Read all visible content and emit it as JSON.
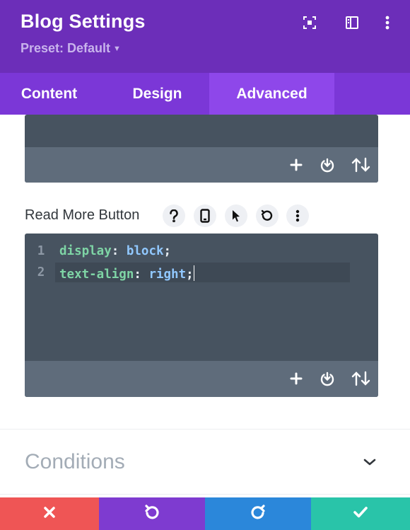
{
  "header": {
    "title": "Blog Settings",
    "preset": "Preset: Default",
    "icons": [
      "focus-icon",
      "sidebar-layout-icon",
      "more-vertical-icon"
    ]
  },
  "tabs": [
    {
      "label": "Content",
      "active": false
    },
    {
      "label": "Design",
      "active": false
    },
    {
      "label": "Advanced",
      "active": true
    }
  ],
  "editor_prev": {
    "actions": [
      "add-icon",
      "download-icon",
      "sort-icon"
    ]
  },
  "read_more": {
    "label": "Read More Button",
    "options": [
      "help-icon",
      "mobile-icon",
      "cursor-icon",
      "reset-icon",
      "more-vertical-icon"
    ],
    "lines": [
      {
        "num": "1",
        "prop": "display",
        "colon": ": ",
        "value": "block",
        "semi": ";"
      },
      {
        "num": "2",
        "prop": "text-align",
        "colon": ": ",
        "value": "right",
        "semi": ";"
      }
    ],
    "actions": [
      "add-icon",
      "download-icon",
      "sort-icon"
    ]
  },
  "conditions": {
    "label": "Conditions",
    "icon": "chevron-down-icon"
  },
  "bottom_bar": {
    "buttons": [
      {
        "name": "cancel",
        "icon": "close-icon",
        "color": "#ef5555"
      },
      {
        "name": "undo",
        "icon": "undo-icon",
        "color": "#7e3bd0"
      },
      {
        "name": "redo",
        "icon": "redo-icon",
        "color": "#2b87da"
      },
      {
        "name": "save",
        "icon": "check-icon",
        "color": "#29c4a9"
      }
    ]
  },
  "colors": {
    "header_bg": "#6c2eb9",
    "tabs_bg": "#7b37d7",
    "active_tab_bg": "#8e47ea",
    "editor_bg": "#475360",
    "editor_footer_bg": "#5f6c7b"
  }
}
